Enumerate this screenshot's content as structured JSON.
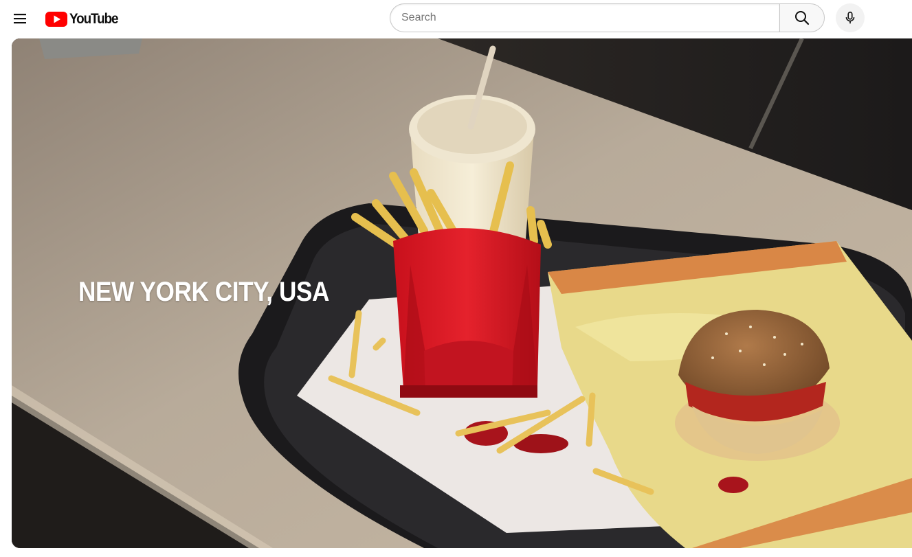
{
  "header": {
    "logo_text": "YouTube",
    "search": {
      "placeholder": "Search",
      "value": ""
    }
  },
  "icons": {
    "menu": "hamburger-menu-icon",
    "logo": "youtube-play-icon",
    "search": "search-icon",
    "mic": "microphone-icon"
  },
  "colors": {
    "brand_red": "#ff0000",
    "text_primary": "#0f0f0f",
    "search_border": "#c6c6c6"
  },
  "video": {
    "overlay_caption": "NEW YORK CITY, USA"
  }
}
